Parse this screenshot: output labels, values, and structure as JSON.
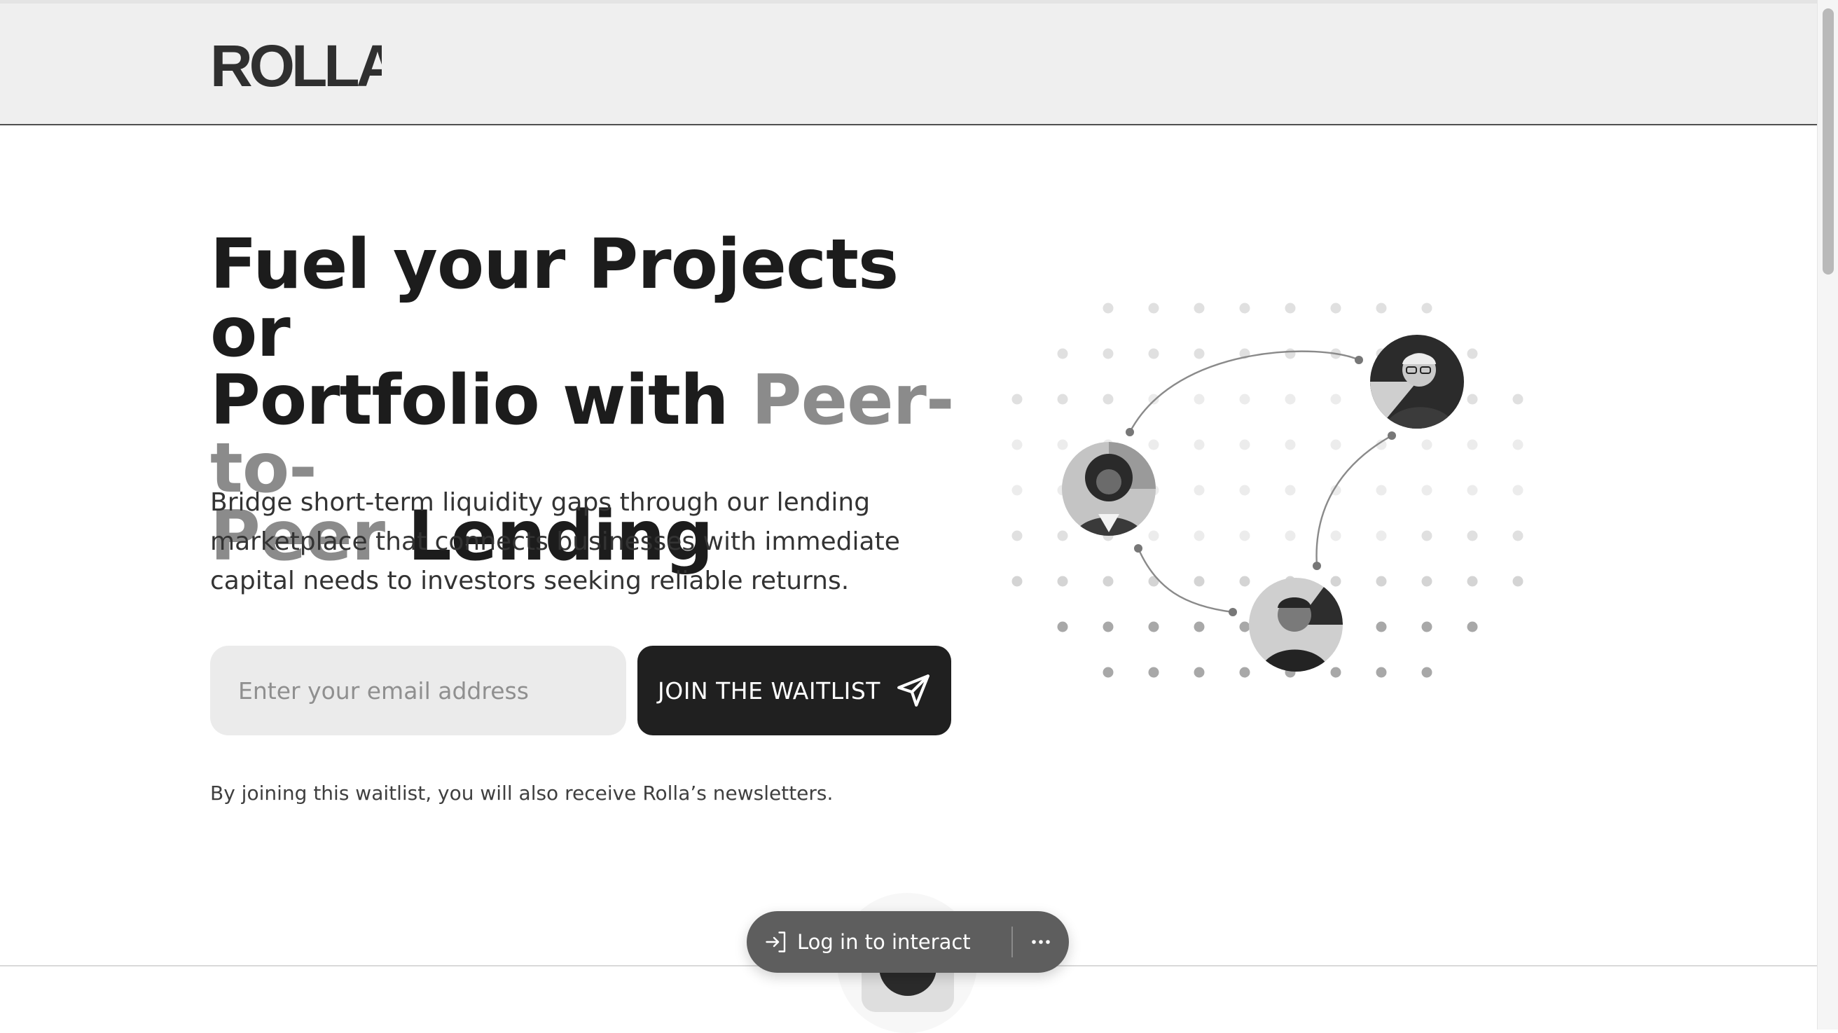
{
  "header": {
    "logo_text": "ROLLA"
  },
  "hero": {
    "headline": {
      "line1": "Fuel your Projects or",
      "line2_main": "Portfolio with ",
      "line2_accent": "Peer-to-",
      "line3_accent": "Peer",
      "line3_main": " Lending"
    },
    "subtext": "Bridge short-term liquidity gaps through our lending marketplace that connects businesses with immediate capital needs to investors seeking reliable returns.",
    "email_placeholder": "Enter your email address",
    "email_value": "",
    "cta_label": "JOIN THE WAITLIST",
    "cta_icon": "paper-plane-icon",
    "disclaimer": "By joining this waitlist, you will also receive Rolla’s newsletters."
  },
  "illustration": {
    "avatars": [
      {
        "name": "avatar-woman",
        "icon": "person-portrait"
      },
      {
        "name": "avatar-man-glasses",
        "icon": "person-portrait"
      },
      {
        "name": "avatar-man-smiling",
        "icon": "person-portrait"
      }
    ]
  },
  "overlay": {
    "login_label": "Log in to interact",
    "login_icon": "login-arrow-icon",
    "more_icon": "ellipsis-icon"
  },
  "colors": {
    "header_bg": "#efefef",
    "accent_text": "#8b8b8b",
    "cta_bg": "#202020",
    "input_bg": "#ebebeb",
    "pill_bg": "#5e5e5e"
  }
}
